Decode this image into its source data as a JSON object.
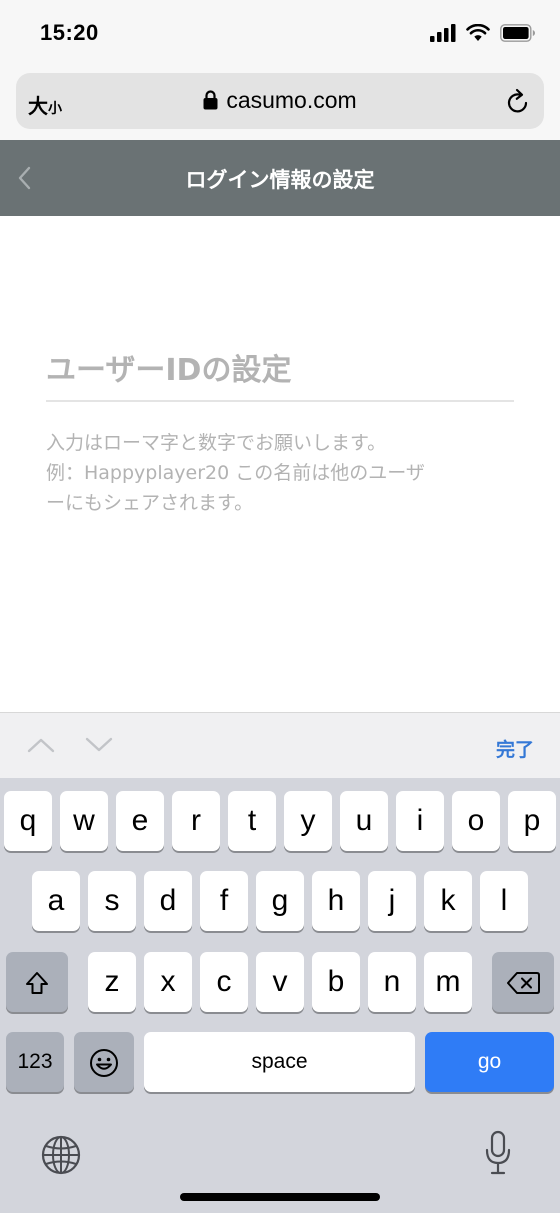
{
  "status_bar": {
    "time": "15:20"
  },
  "browser": {
    "text_size_label": "大",
    "text_size_small": "小",
    "url": "casumo.com"
  },
  "header": {
    "title": "ログイン情報の設定"
  },
  "form": {
    "username": {
      "value": "",
      "placeholder": "ユーザーIDの設定"
    },
    "help_lines": [
      "入力はローマ字と数字でお願いします。",
      "例：Happyplayer20 この名前は他のユーザ",
      "ーにもシェアされます。"
    ]
  },
  "accessory_bar": {
    "done_label": "完了"
  },
  "keyboard": {
    "row1": [
      "q",
      "w",
      "e",
      "r",
      "t",
      "y",
      "u",
      "i",
      "o",
      "p"
    ],
    "row2": [
      "a",
      "s",
      "d",
      "f",
      "g",
      "h",
      "j",
      "k",
      "l"
    ],
    "row3": [
      "z",
      "x",
      "c",
      "v",
      "b",
      "n",
      "m"
    ],
    "numbers_label": "123",
    "space_label": "space",
    "go_label": "go"
  },
  "icons": {
    "signal": "cellular-signal-icon",
    "wifi": "wifi-icon",
    "battery": "battery-icon",
    "lock": "lock-icon",
    "reload": "reload-icon",
    "back": "chevron-left-icon",
    "shift": "shift-icon",
    "delete": "delete-icon",
    "emoji": "emoji-icon",
    "globe": "globe-icon",
    "mic": "microphone-icon"
  },
  "colors": {
    "header_bg": "#6a7274",
    "go_key": "#2f7cf6",
    "done_link": "#3478d6",
    "keyboard_bg": "#d3d5dc"
  }
}
